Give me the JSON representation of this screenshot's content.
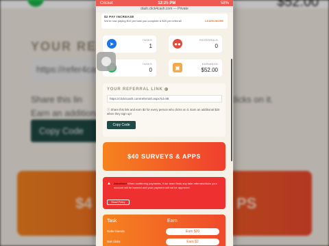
{
  "status_bar": {
    "carrier": "Cricket",
    "time": "12:25 PM",
    "battery": "58%"
  },
  "url": "dash.click4cash.com — Private",
  "pay_notice": {
    "title": "$2 PAY INCREASE",
    "text": "We're now paying $10 per task you complete & $20 per referral!",
    "more": "LEARN MORE"
  },
  "stats": [
    {
      "label": "TASKS",
      "value": "1",
      "icon": "cursor-icon",
      "color": "#1b74e8"
    },
    {
      "label": "REFERRALS",
      "value": "0",
      "icon": "people-icon",
      "color": "#e24a3b"
    },
    {
      "label": "TASKS",
      "value": "0",
      "icon": "list-icon",
      "color": "#1fb44a"
    },
    {
      "label": "EARNINGS",
      "value": "$52.00",
      "icon": "wallet-icon",
      "color": "#f2a94a"
    }
  ],
  "referral": {
    "heading": "YOUR REFERRAL LINK",
    "link": "https://click4cash.com/referral/r.aspx?id=88",
    "info": "Share this link and earn $2 for every person who clicks on it. Earn an additional $20 when they sign up!",
    "copy_label": "Copy Code"
  },
  "banner": {
    "label": "$40 SURVEYS & APPS"
  },
  "warning": {
    "lead": "Attention!",
    "text": "When confirming payments, if our team finds any fake referrals/clicks your account will be banned and your payment will not be approved.",
    "button": "Read Policy"
  },
  "tasks": {
    "task_header": "Task",
    "earn_header": "Earn",
    "rows": [
      {
        "task": "Refer friends",
        "earn": "Earn $20"
      },
      {
        "task": "Get clicks",
        "earn": "Earn $2"
      }
    ]
  },
  "background": {
    "title": "YOUR REFERRA",
    "link": "https://refer4cash.c",
    "info_left": "Share this lin",
    "info_left2": "Earn an additional",
    "info_right": "clicks on it.",
    "copy": "Copy Code",
    "amount": "$52.00",
    "orange_left": "$4",
    "orange_right": "PS"
  }
}
